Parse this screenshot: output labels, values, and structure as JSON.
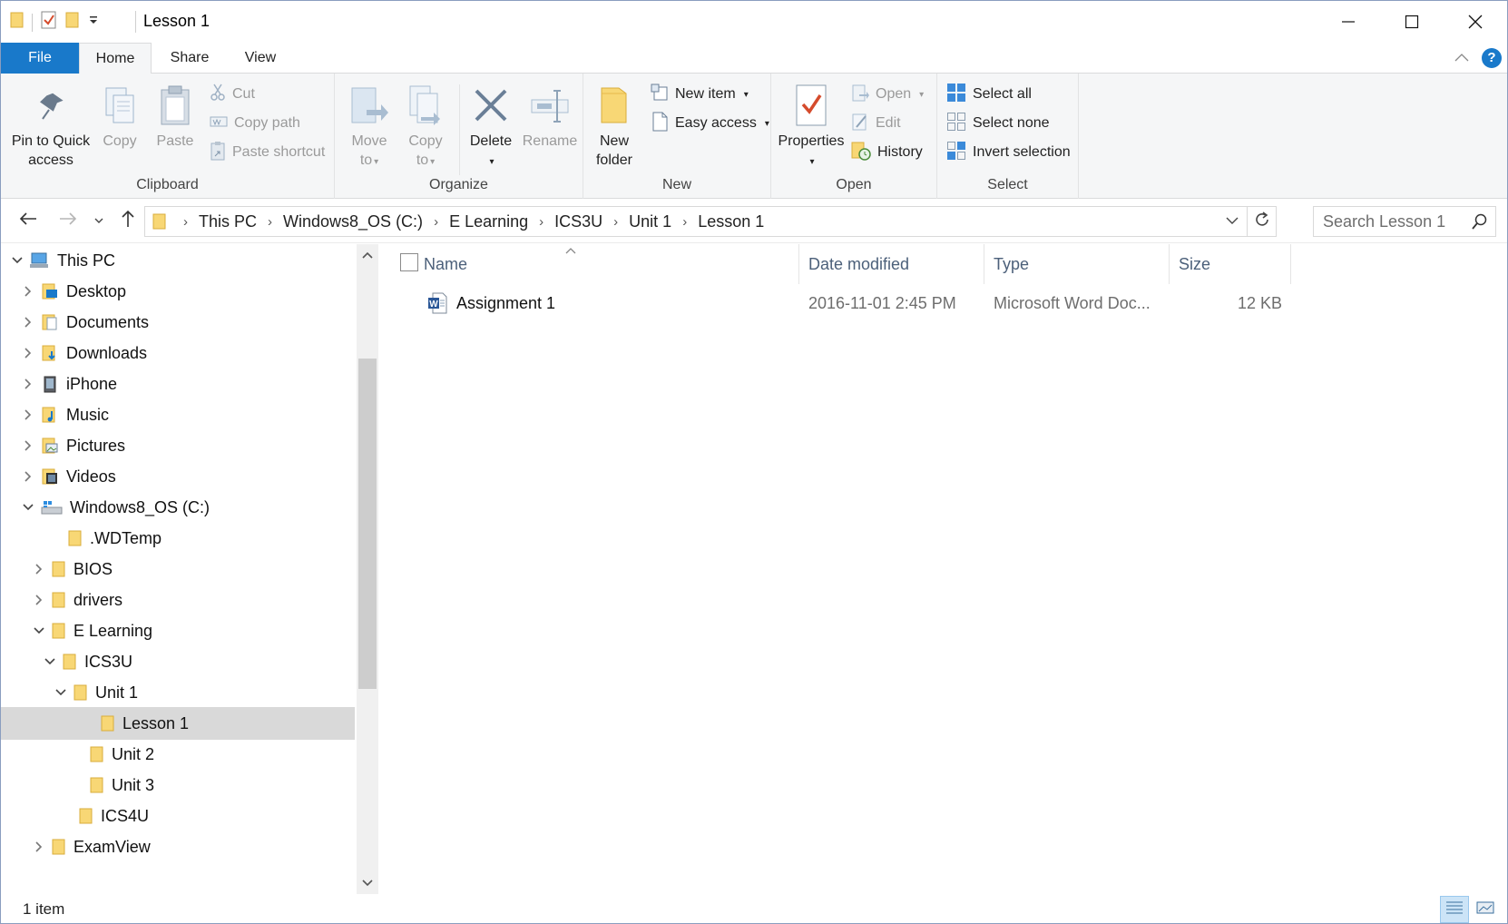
{
  "window": {
    "title": "Lesson 1",
    "controls": [
      "minimize",
      "maximize",
      "close"
    ]
  },
  "ribbon_tabs": {
    "file": "File",
    "home": "Home",
    "share": "Share",
    "view": "View"
  },
  "clipboard": {
    "pin_line1": "Pin to Quick",
    "pin_line2": "access",
    "copy": "Copy",
    "paste": "Paste",
    "cut": "Cut",
    "copy_path": "Copy path",
    "paste_shortcut": "Paste shortcut",
    "label": "Clipboard"
  },
  "organize": {
    "move_line1": "Move",
    "move_line2": "to",
    "copy_line1": "Copy",
    "copy_line2": "to",
    "delete": "Delete",
    "rename": "Rename",
    "label": "Organize"
  },
  "new_group": {
    "new_folder_line1": "New",
    "new_folder_line2": "folder",
    "new_item": "New item",
    "easy_access": "Easy access",
    "label": "New"
  },
  "open_group": {
    "properties": "Properties",
    "open": "Open",
    "edit": "Edit",
    "history": "History",
    "label": "Open"
  },
  "select_group": {
    "select_all": "Select all",
    "select_none": "Select none",
    "invert_selection": "Invert selection",
    "label": "Select"
  },
  "address": {
    "crumbs": [
      "This PC",
      "Windows8_OS (C:)",
      "E Learning",
      "ICS3U",
      "Unit 1",
      "Lesson 1"
    ],
    "search_placeholder": "Search Lesson 1"
  },
  "tree": [
    {
      "label": "This PC",
      "expanded": true
    },
    {
      "label": "Desktop"
    },
    {
      "label": "Documents"
    },
    {
      "label": "Downloads"
    },
    {
      "label": "iPhone"
    },
    {
      "label": "Music"
    },
    {
      "label": "Pictures"
    },
    {
      "label": "Videos"
    },
    {
      "label": "Windows8_OS (C:)",
      "expanded": true
    },
    {
      "label": ".WDTemp"
    },
    {
      "label": "BIOS"
    },
    {
      "label": "drivers"
    },
    {
      "label": "E Learning",
      "expanded": true
    },
    {
      "label": "ICS3U",
      "expanded": true
    },
    {
      "label": "Unit 1",
      "expanded": true
    },
    {
      "label": "Lesson 1",
      "selected": true
    },
    {
      "label": "Unit 2"
    },
    {
      "label": "Unit 3"
    },
    {
      "label": "ICS4U"
    },
    {
      "label": "ExamView"
    }
  ],
  "columns": {
    "name": "Name",
    "date_modified": "Date modified",
    "type": "Type",
    "size": "Size"
  },
  "files": [
    {
      "name": "Assignment 1",
      "date_modified": "2016-11-01 2:45 PM",
      "type": "Microsoft Word Doc...",
      "size": "12 KB",
      "icon": "word-document-icon"
    }
  ],
  "status": {
    "item_count": "1 item"
  },
  "colors": {
    "accent": "#1979ca",
    "folder": "#f8d775",
    "selected_row": "#d9d9d9"
  }
}
